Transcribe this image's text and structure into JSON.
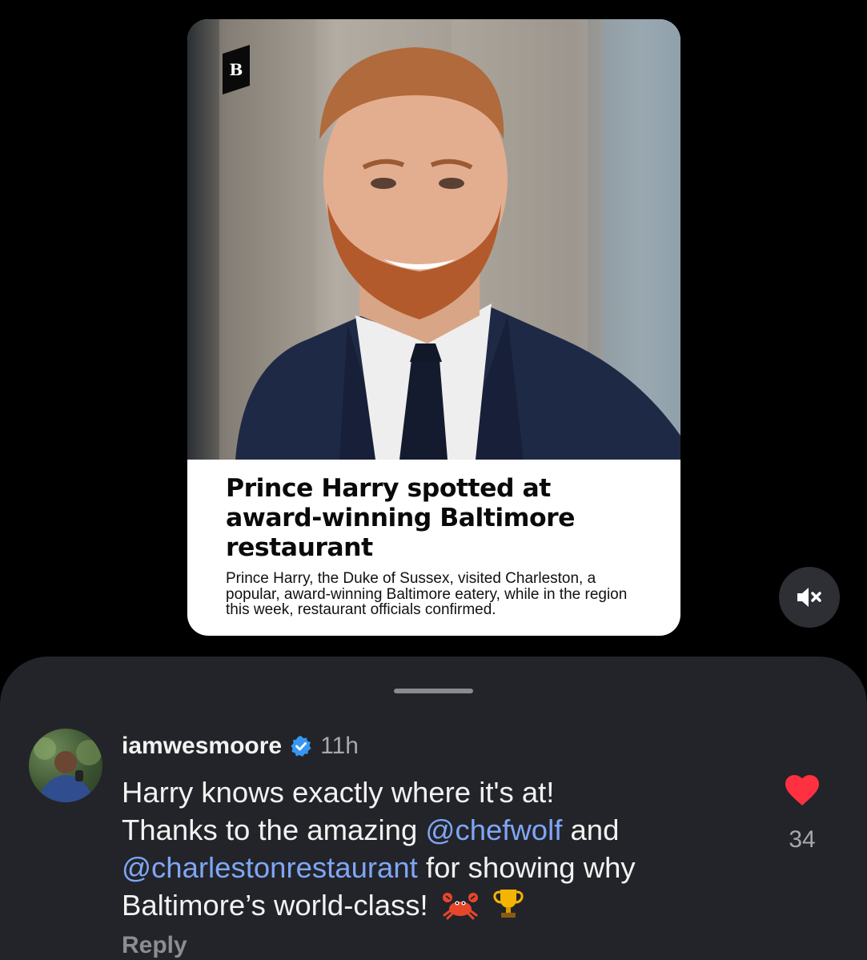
{
  "article": {
    "brand_letter": "B",
    "headline": "Prince Harry spotted at award-winning Baltimore restaurant",
    "dek": "Prince Harry, the Duke of Sussex, visited Charleston, a popular, award-winning Baltimore eatery, while in the region this week, restaurant officials confirmed."
  },
  "media_controls": {
    "mute_icon": "speaker-muted-icon"
  },
  "comment": {
    "username": "iamwesmoore",
    "verified_icon": "verified-badge-icon",
    "timestamp": "11h",
    "text_parts": {
      "line1": "Harry knows exactly where it's at!",
      "line2_prefix": "Thanks to the amazing ",
      "mention1": "@chefwolf",
      "line2_suffix": " and",
      "mention2": "@charlestonrestaurant",
      "line3_suffix": " for showing why",
      "line4": "Baltimore’s world-class!"
    },
    "emojis": [
      "crab-emoji",
      "trophy-emoji"
    ],
    "reply_label": "Reply",
    "likes": "34",
    "liked": true,
    "like_color": "#ff3040"
  },
  "colors": {
    "background": "#000000",
    "sheet": "#232429",
    "mention": "#7fa6f5",
    "verified": "#3797f0"
  }
}
